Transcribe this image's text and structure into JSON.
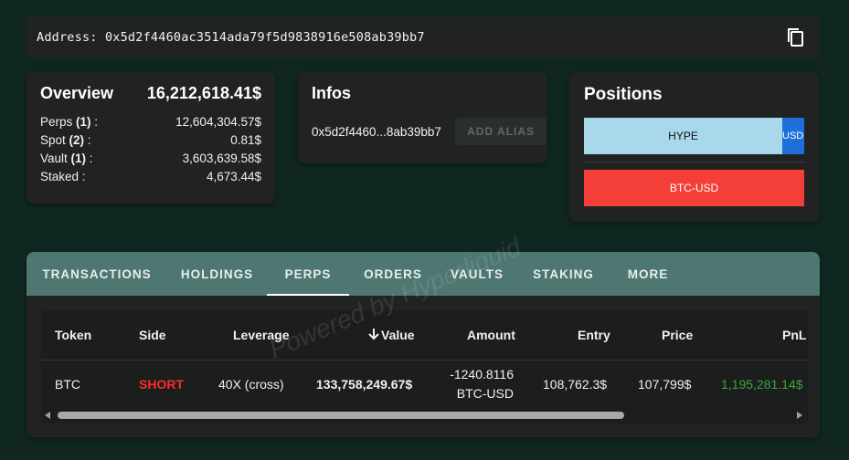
{
  "address": {
    "text": "Address: 0x5d2f4460ac3514ada79f5d9838916e508ab39bb7",
    "copy_icon": "copy-icon"
  },
  "overview": {
    "title": "Overview",
    "total": "16,212,618.41$",
    "rows": [
      {
        "label": "Perps",
        "count": "(1)",
        "suffix": " :",
        "value": "12,604,304.57$"
      },
      {
        "label": "Spot",
        "count": "(2)",
        "suffix": " :",
        "value": "0.81$"
      },
      {
        "label": "Vault",
        "count": "(1)",
        "suffix": " :",
        "value": "3,603,639.58$"
      },
      {
        "label": "Staked",
        "count": "",
        "suffix": " :",
        "value": "4,673.44$"
      }
    ]
  },
  "infos": {
    "title": "Infos",
    "short_address": "0x5d2f4460...8ab39bb7",
    "alias_button": "ADD ALIAS"
  },
  "positions": {
    "title": "Positions",
    "bars": [
      {
        "label": "HYPE",
        "secondary_label": "USDC",
        "color": "#a9d8ea",
        "secondary_color": "#1e6fd9"
      },
      {
        "label": "BTC-USD",
        "color": "#f43f38"
      }
    ]
  },
  "tabs": [
    {
      "label": "TRANSACTIONS",
      "active": false
    },
    {
      "label": "HOLDINGS",
      "active": false
    },
    {
      "label": "PERPS",
      "active": true
    },
    {
      "label": "ORDERS",
      "active": false
    },
    {
      "label": "VAULTS",
      "active": false
    },
    {
      "label": "STAKING",
      "active": false
    },
    {
      "label": "MORE",
      "active": false
    }
  ],
  "table": {
    "headers": {
      "token": "Token",
      "side": "Side",
      "leverage": "Leverage",
      "value": "Value",
      "value_sort_icon": "arrow-down-icon",
      "amount": "Amount",
      "entry": "Entry",
      "price": "Price",
      "pnl": "PnL"
    },
    "rows": [
      {
        "token": "BTC",
        "side": "SHORT",
        "leverage": "40X (cross)",
        "value": "133,758,249.67$",
        "amount_line1": "-1240.8116",
        "amount_line2": "BTC-USD",
        "entry": "108,762.3$",
        "price": "107,799$",
        "pnl": "1,195,281.14$"
      }
    ]
  },
  "watermark": "Powered by Hyperliquid",
  "colors": {
    "background": "#0f2720",
    "card": "#212323",
    "tab_bar": "#4e7771",
    "short": "#ff2b2b",
    "pnl_positive": "#3aa63a"
  }
}
